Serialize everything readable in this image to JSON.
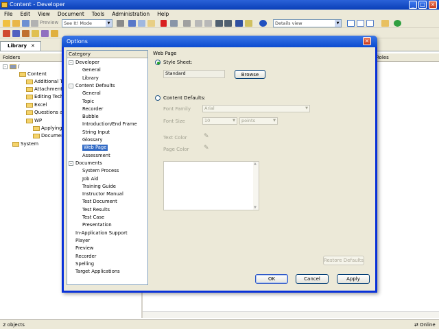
{
  "window": {
    "title": "Content - Developer"
  },
  "menu": [
    "File",
    "Edit",
    "View",
    "Document",
    "Tools",
    "Administration",
    "Help"
  ],
  "toolbar": {
    "preview_label": "Preview",
    "mode_value": "See It! Mode",
    "view_value": "Details view"
  },
  "library": {
    "tab_label": "Library",
    "folders_header": "Folders",
    "roles_header": "Roles",
    "tree": [
      {
        "label": "Content",
        "level": 1
      },
      {
        "label": "Additional Top",
        "level": 2
      },
      {
        "label": "Attachments",
        "level": 2
      },
      {
        "label": "Editing Techni",
        "level": 2
      },
      {
        "label": "Excel",
        "level": 2
      },
      {
        "label": "Questions and",
        "level": 2
      },
      {
        "label": "WP",
        "level": 2
      },
      {
        "label": "Applying",
        "level": 3
      },
      {
        "label": "Documen",
        "level": 3
      },
      {
        "label": "System",
        "level": 1
      }
    ]
  },
  "status": {
    "objects": "2 objects",
    "online": "Online"
  },
  "dialog": {
    "title": "Options",
    "category_header": "Category",
    "categories": [
      {
        "label": "Developer",
        "level": 0,
        "expander": "-"
      },
      {
        "label": "General",
        "level": 1
      },
      {
        "label": "Library",
        "level": 1
      },
      {
        "label": "Content Defaults",
        "level": 0,
        "expander": "-"
      },
      {
        "label": "General",
        "level": 1
      },
      {
        "label": "Topic",
        "level": 1
      },
      {
        "label": "Recorder",
        "level": 1
      },
      {
        "label": "Bubble",
        "level": 1
      },
      {
        "label": "Introduction/End Frame",
        "level": 1
      },
      {
        "label": "String Input",
        "level": 1
      },
      {
        "label": "Glossary",
        "level": 1
      },
      {
        "label": "Web Page",
        "level": 1,
        "selected": true
      },
      {
        "label": "Assessment",
        "level": 1
      },
      {
        "label": "Documents",
        "level": 0,
        "expander": "-"
      },
      {
        "label": "System Process",
        "level": 1
      },
      {
        "label": "Job Aid",
        "level": 1
      },
      {
        "label": "Training Guide",
        "level": 1
      },
      {
        "label": "Instructor Manual",
        "level": 1
      },
      {
        "label": "Test Document",
        "level": 1
      },
      {
        "label": "Test Results",
        "level": 1
      },
      {
        "label": "Test Case",
        "level": 1
      },
      {
        "label": "Presentation",
        "level": 1
      },
      {
        "label": "In-Application Support",
        "level": 0
      },
      {
        "label": "Player",
        "level": 0
      },
      {
        "label": "Preview",
        "level": 0
      },
      {
        "label": "Recorder",
        "level": 0
      },
      {
        "label": "Spelling",
        "level": 0
      },
      {
        "label": "Target Applications",
        "level": 0
      }
    ],
    "panel": {
      "heading": "Web Page",
      "style_sheet_label": "Style Sheet:",
      "style_sheet_value": "Standard",
      "browse_label": "Browse",
      "content_defaults_label": "Content Defaults:",
      "font_family_label": "Font Family",
      "font_family_value": "Arial",
      "font_size_label": "Font Size",
      "font_size_value": "10",
      "font_unit_value": "points",
      "text_color_label": "Text Color",
      "page_color_label": "Page Color",
      "restore_label": "Restore Defaults"
    },
    "buttons": {
      "ok": "OK",
      "cancel": "Cancel",
      "apply": "Apply"
    }
  }
}
